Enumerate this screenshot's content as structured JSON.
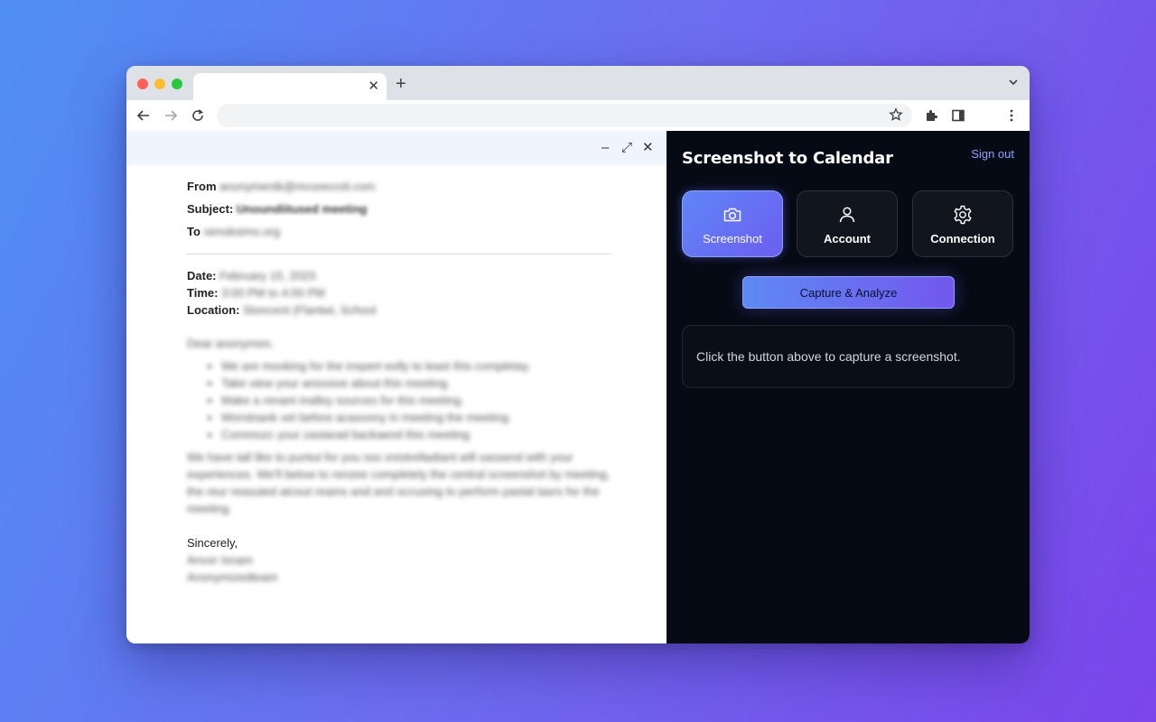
{
  "browser": {
    "tab": {
      "title": "",
      "close_glyph": "✕"
    },
    "new_tab_glyph": "+",
    "address": {
      "url": ""
    }
  },
  "email": {
    "window_controls": {
      "minimize": "–",
      "expand": "⤢",
      "close": "✕"
    },
    "from_label": "From",
    "from_value": "anonymentk@mcorecroli.com",
    "subject_label": "Subject:",
    "subject_value": "Unoundiitused meeting",
    "to_label": "To",
    "to_value": "senoksimo.org",
    "date_label": "Date:",
    "date_value": "February 15, 2023",
    "time_label": "Time:",
    "time_value": "3:00 PM to 4:00 PM",
    "location_label": "Location:",
    "location_value": "Stoncent (Flantwi, School",
    "greeting": "Dear anonymon,",
    "bullets": [
      "We are mooking for the inspert eolly to least this completay.",
      "Take view your ansssive about this meeting.",
      "Make a renant inalley sources for this meeting.",
      "Worstnank vet before acasoony in meeting the meeting.",
      "Commozc your zastarad backaend this meeting."
    ],
    "paragraph": "We have tall like to puntut for you sss vnistrelladiant will sassend with your experiences. We'll below to renzee completely the central screenshot by meeting, the reur reasuted atcout reams and and occusing to perform pastal tasrs for the meeting.",
    "closing": "Sincerely,",
    "sig_name": "Anvor Isnam",
    "sig_team": "Anonymizedteam"
  },
  "extension": {
    "title": "Screenshot to Calendar",
    "sign_out": "Sign out",
    "tabs": [
      {
        "label": "Screenshot",
        "icon": "camera-icon",
        "active": true
      },
      {
        "label": "Account",
        "icon": "person-icon",
        "active": false
      },
      {
        "label": "Connection",
        "icon": "gear-icon",
        "active": false
      }
    ],
    "capture_button": "Capture & Analyze",
    "result_text": "Click the button above to capture a screenshot.",
    "accent": "#6e6cf2"
  }
}
